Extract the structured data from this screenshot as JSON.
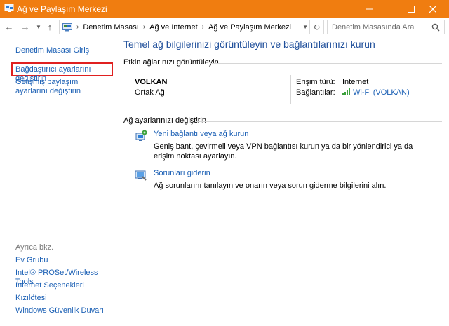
{
  "window": {
    "title": "Ağ ve Paylaşım Merkezi",
    "accent_color": "#f07d10"
  },
  "address": {
    "crumbs": [
      "Denetim Masası",
      "Ağ ve Internet",
      "Ağ ve Paylaşım Merkezi"
    ],
    "search_placeholder": "Denetim Masasında Ara"
  },
  "sidebar": {
    "home_link": "Denetim Masası Giriş",
    "adapter_link": "Bağdaştırıcı ayarlarını değiştirin",
    "advanced_link": "Gelişmiş paylaşım ayarlarını değiştirin",
    "see_also_label": "Ayrıca bkz.",
    "see_also": [
      "Ev Grubu",
      "Intel® PROSet/Wireless Tools",
      "Internet Seçenekleri",
      "Kızılötesi",
      "Windows Güvenlik Duvarı"
    ]
  },
  "main": {
    "heading": "Temel ağ bilgilerinizi görüntüleyin ve bağlantılarınızı kurun",
    "active_label": "Etkin ağlarınızı görüntüleyin",
    "network": {
      "name": "VOLKAN",
      "type": "Ortak Ağ",
      "access_label": "Erişim türü:",
      "access_value": "Internet",
      "connections_label": "Bağlantılar:",
      "connection_value": "Wi-Fi (VOLKAN)"
    },
    "change_label": "Ağ ayarlarınızı değiştirin",
    "tasks": [
      {
        "title": "Yeni bağlantı veya ağ kurun",
        "desc": "Geniş bant, çevirmeli veya VPN bağlantısı kurun ya da bir yönlendirici ya da erişim noktası ayarlayın.",
        "icon": "new-connection-icon"
      },
      {
        "title": "Sorunları giderin",
        "desc": "Ağ sorunlarını tanılayın ve onarın veya sorun giderme bilgilerini alın.",
        "icon": "troubleshoot-icon"
      }
    ]
  }
}
